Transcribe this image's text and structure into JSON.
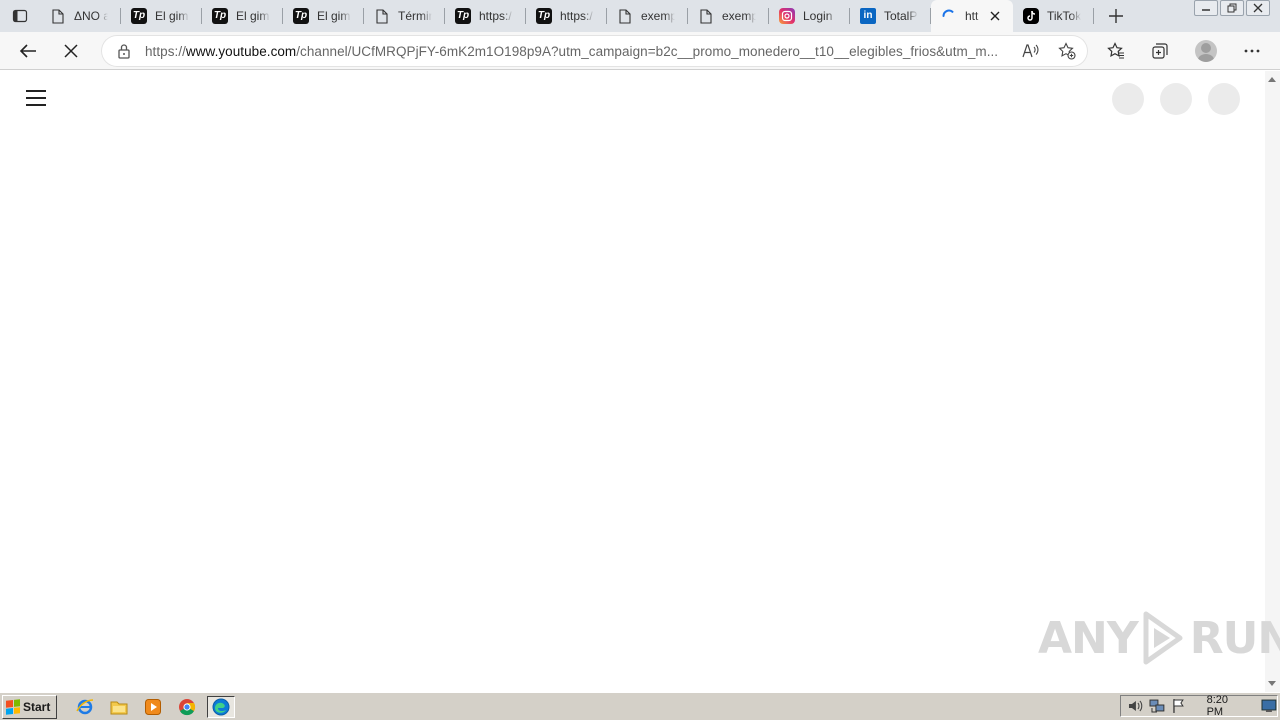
{
  "browser": {
    "tabs": [
      {
        "title": "ΔNO a",
        "icon": "page-icon"
      },
      {
        "title": "El gim",
        "icon": "tp-logo-icon"
      },
      {
        "title": "El gim",
        "icon": "tp-logo-icon"
      },
      {
        "title": "El gim",
        "icon": "tp-logo-icon"
      },
      {
        "title": "Término",
        "icon": "page-icon"
      },
      {
        "title": "https:/",
        "icon": "tp-logo-icon"
      },
      {
        "title": "https:/",
        "icon": "tp-logo-icon"
      },
      {
        "title": "exemp",
        "icon": "page-icon"
      },
      {
        "title": "exemp",
        "icon": "page-icon"
      },
      {
        "title": "Login",
        "icon": "instagram-icon"
      },
      {
        "title": "TotalP",
        "icon": "linkedin-icon"
      },
      {
        "title": "htt",
        "icon": "loading-spinner-icon",
        "active": true
      },
      {
        "title": "TikTok",
        "icon": "tiktok-icon"
      }
    ],
    "url_scheme": "https://",
    "url_host": "www.youtube.com",
    "url_path": "/channel/UCfMRQPjFY-6mK2m1O198p9A?utm_campaign=b2c__promo_monedero__t10__elegibles_frios&utm_m...",
    "colors": {
      "tabstrip": "#dfe3e8",
      "toolbar": "#f7f7f7",
      "spinner": "#1a73e8"
    }
  },
  "page": {
    "placeholder_circles": 3
  },
  "watermark": {
    "left": "ANY",
    "right": "RUN"
  },
  "taskbar": {
    "start_label": "Start",
    "quick_launch": [
      "internet-explorer-icon",
      "folder-icon",
      "media-player-icon",
      "chrome-icon",
      "edge-icon"
    ],
    "clock": "8:20 PM"
  }
}
